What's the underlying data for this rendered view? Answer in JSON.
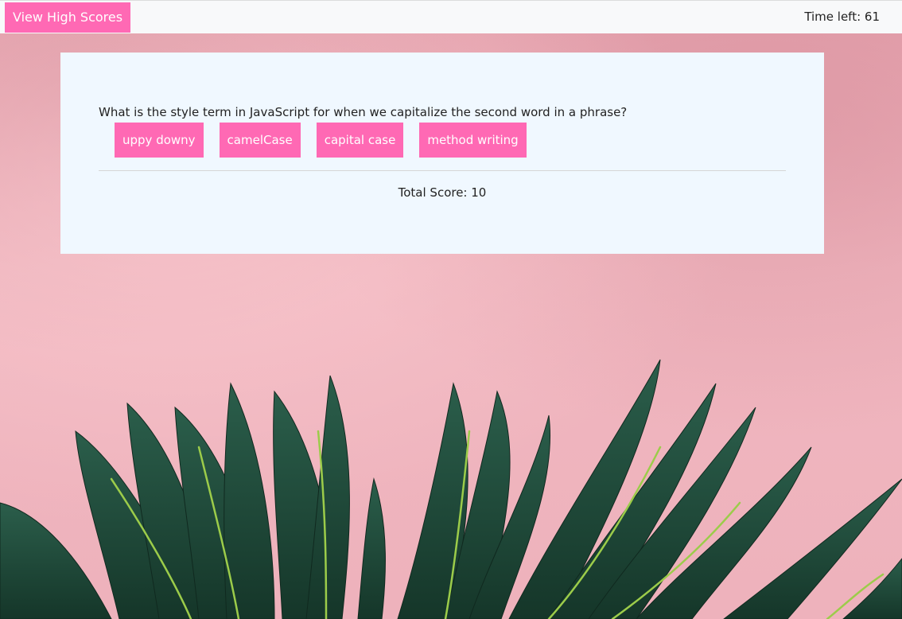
{
  "header": {
    "high_scores_label": "View High Scores",
    "timer_text": "Time left: 61"
  },
  "quiz": {
    "question": "What is the style term in JavaScript for when we capitalize the second word in a phrase?",
    "answers": [
      {
        "label": "uppy downy"
      },
      {
        "label": "camelCase"
      },
      {
        "label": "capital case"
      },
      {
        "label": "method writing"
      }
    ],
    "score_text": "Total Score: 10"
  },
  "colors": {
    "accent": "#ff69b4",
    "card_bg": "#f0f8ff",
    "topbar_bg": "#f8f9fa",
    "wall_pink": "#eeb2bc",
    "leaf_green": "#1f4a3c",
    "leaf_rib": "#9ccc4a"
  },
  "background": {
    "icon": "palm-leaves-image"
  }
}
